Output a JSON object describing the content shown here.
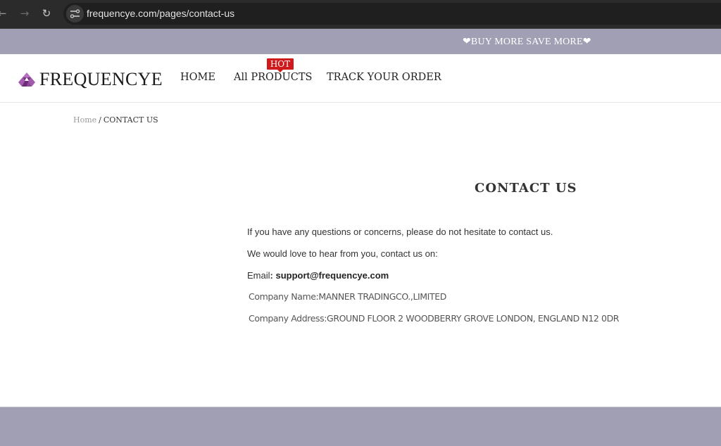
{
  "browser": {
    "url": "frequencye.com/pages/contact-us",
    "back_icon": "arrow-left",
    "forward_icon": "arrow-right",
    "reload_icon": "reload"
  },
  "announcement": {
    "text": "❤BUY MORE SAVE MORE❤"
  },
  "header": {
    "brand": "FREQUENCYE",
    "nav": [
      {
        "label": "HOME"
      },
      {
        "label": "All PRODUCTS",
        "badge": "HOT"
      },
      {
        "label": "TRACK YOUR ORDER"
      }
    ]
  },
  "breadcrumb": {
    "home": "Home",
    "separator": "/",
    "current": "CONTACT US"
  },
  "content": {
    "title": "CONTACT US",
    "line1": "If you have any questions or concerns, please do not hesitate to contact us.",
    "line2": "We would love to hear from you, contact us on:",
    "email_label": "Email",
    "email_colon": ": ",
    "email": "support@frequencye.com",
    "company_name": "Company Name:MANNER TRADINGCO.,LIMITED",
    "company_address": "Company Address:GROUND FLOOR 2 WOODBERRY GROVE LONDON, ENGLAND N12 0DR"
  },
  "colors": {
    "announcement_bg": "#a19fb4",
    "footer_bg": "#a19fb4",
    "hot_badge": "#d0191b",
    "logo_accent": "#8a3d8f"
  }
}
